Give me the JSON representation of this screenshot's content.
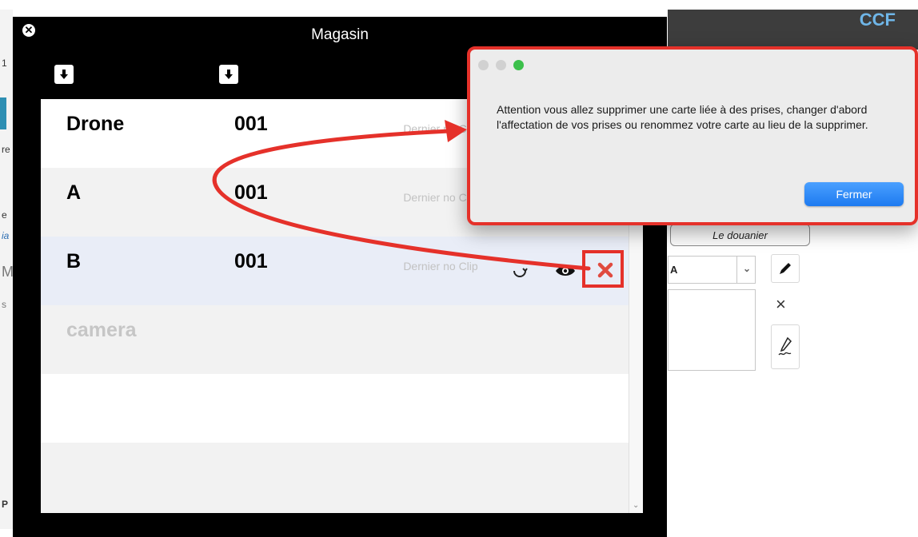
{
  "app": {
    "brand": "CCF",
    "left_fragments": [
      "1",
      "re",
      "e",
      "ia",
      "M",
      "s",
      "P"
    ],
    "douanier_label": "Le douanier",
    "select_value": "A"
  },
  "magasin": {
    "title": "Magasin",
    "rows": [
      {
        "name": "Drone",
        "number": "001",
        "clip": "Dernier no Clip"
      },
      {
        "name": "A",
        "number": "001",
        "clip": "Dernier no Clip"
      },
      {
        "name": "B",
        "number": "001",
        "clip": "Dernier no Clip"
      },
      {
        "name": "camera"
      }
    ]
  },
  "alert": {
    "message": "Attention vous allez supprimer une carte liée à des prises, changer d'abord l'affectation de vos prises ou renommez votre carte au lieu de la supprimer.",
    "button_label": "Fermer"
  },
  "colors": {
    "annotation_red": "#e5312a",
    "accent_blue": "#1d7af0",
    "brand_blue": "#6fb6e8"
  }
}
